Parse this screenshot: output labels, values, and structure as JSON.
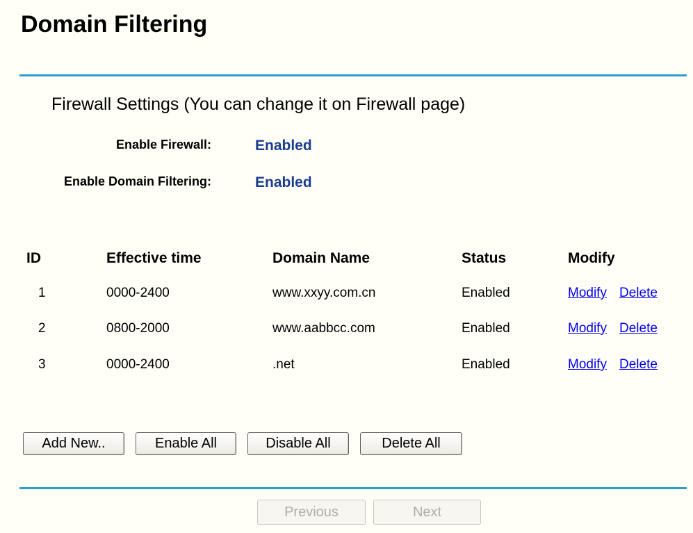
{
  "page": {
    "title": "Domain Filtering"
  },
  "firewall": {
    "section_title": "Firewall Settings (You can change it on Firewall page)",
    "enable_firewall_label": "Enable Firewall:",
    "enable_firewall_value": "Enabled",
    "enable_domain_filtering_label": "Enable Domain Filtering:",
    "enable_domain_filtering_value": "Enabled"
  },
  "table": {
    "headers": {
      "id": "ID",
      "effective_time": "Effective time",
      "domain_name": "Domain Name",
      "status": "Status",
      "modify": "Modify"
    },
    "rows": [
      {
        "id": "1",
        "effective_time": "0000-2400",
        "domain_name": "www.xxyy.com.cn",
        "status": "Enabled",
        "modify_label": "Modify",
        "delete_label": "Delete"
      },
      {
        "id": "2",
        "effective_time": "0800-2000",
        "domain_name": "www.aabbcc.com",
        "status": "Enabled",
        "modify_label": "Modify",
        "delete_label": "Delete"
      },
      {
        "id": "3",
        "effective_time": "0000-2400",
        "domain_name": ".net",
        "status": "Enabled",
        "modify_label": "Modify",
        "delete_label": "Delete"
      }
    ]
  },
  "actions": {
    "add_new": "Add New..",
    "enable_all": "Enable All",
    "disable_all": "Disable All",
    "delete_all": "Delete All"
  },
  "pagination": {
    "previous": "Previous",
    "next": "Next"
  },
  "colors": {
    "background": "#fffff7",
    "rule": "#2a9fd0",
    "status_value": "#1a3d8f",
    "link": "#0000ee"
  }
}
